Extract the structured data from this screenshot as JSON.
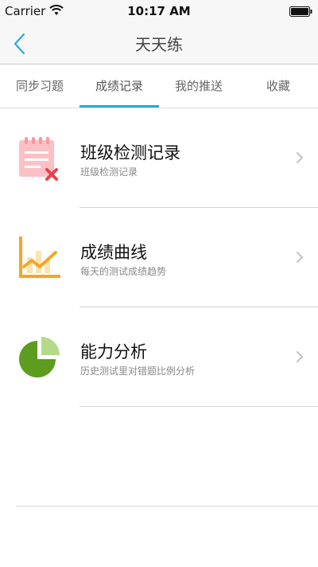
{
  "status_bar": {
    "carrier": "Carrier",
    "time": "10:17 AM"
  },
  "nav": {
    "title": "天天练",
    "back_icon": "chevron-left-icon",
    "accent_color": "#29a9e0"
  },
  "tabs": [
    {
      "label": "同步习题",
      "active": false
    },
    {
      "label": "成绩记录",
      "active": true
    },
    {
      "label": "我的推送",
      "active": false
    },
    {
      "label": "收藏",
      "active": false
    }
  ],
  "items": [
    {
      "title": "班级检测记录",
      "subtitle": "班级检测记录",
      "icon": "class-record-icon",
      "icon_color": "#f9b3b8"
    },
    {
      "title": "成绩曲线",
      "subtitle": "每天的测试成绩趋势",
      "icon": "score-curve-icon",
      "icon_color": "#f5a623"
    },
    {
      "title": "能力分析",
      "subtitle": "历史测试里对错题比例分析",
      "icon": "pie-chart-icon",
      "icon_color": "#5d9c1f"
    }
  ]
}
